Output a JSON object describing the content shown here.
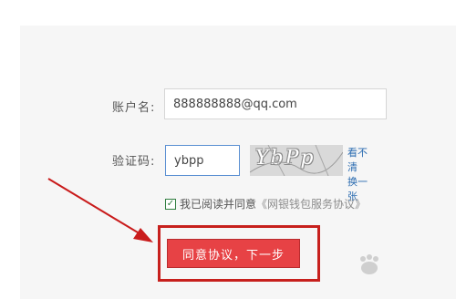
{
  "account": {
    "label": "账户名:",
    "value": "888888888@qq.com"
  },
  "verification": {
    "label": "验证码:",
    "value": "ybpp",
    "captcha_text": "YbPp",
    "refresh_link": "看不清\n换一张"
  },
  "agreement": {
    "text": "我已阅读并同意",
    "link": "《网银钱包服务协议》",
    "checked": true
  },
  "submit": {
    "label": "同意协议，下一步"
  },
  "colors": {
    "accent_red": "#e74245",
    "highlight_red": "#c7201d",
    "link_blue": "#2a6bb0"
  },
  "icons": {
    "checkbox": "checkmark-icon",
    "arrow": "annotation-arrow-icon",
    "watermark": "baidu-paw-icon"
  }
}
